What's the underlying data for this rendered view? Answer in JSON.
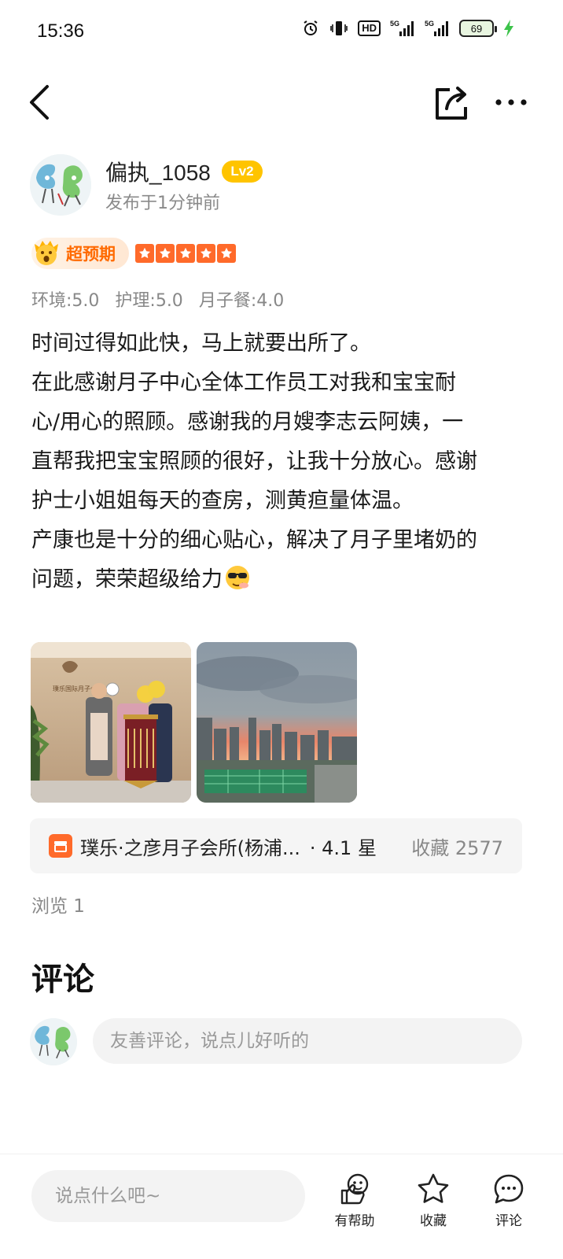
{
  "status_bar": {
    "time": "15:36",
    "icons": [
      "alarm-icon",
      "vibrate-icon",
      "hd-icon",
      "signal-5g-icon",
      "signal-5g-icon"
    ],
    "hd_label": "HD",
    "battery": "69"
  },
  "nav": {
    "icons": [
      "back-arrow-icon",
      "share-icon",
      "more-icon"
    ]
  },
  "author": {
    "name": "偏执_1058",
    "level": "Lv2",
    "posted": "发布于1分钟前"
  },
  "rating": {
    "tag": "超预期",
    "stars": 5,
    "sub": [
      {
        "label": "环境:5.0"
      },
      {
        "label": "护理:5.0"
      },
      {
        "label": "月子餐:4.0"
      }
    ]
  },
  "review": {
    "lines": [
      "时间过得如此快，马上就要出所了。",
      "在此感谢月子中心全体工作员工对我和宝宝耐",
      "心/用心的照顾。感谢我的月嫂李志云阿姨，一",
      "直帮我把宝宝照顾的很好，让我十分放心。感谢",
      "护士小姐姐每天的查房，测黄疸量体温。",
      "产康也是十分的细心贴心，解决了月子里堵奶的",
      "问题，荣荣超级给力"
    ],
    "emoji": "sunglasses-emoji-icon"
  },
  "photos": [
    {
      "alt": "photo-group-banner"
    },
    {
      "alt": "photo-city-sunset"
    }
  ],
  "photo1_texts": {
    "sign": "璞乐国际月子会所",
    "logo": "Fo"
  },
  "place": {
    "name": "璞乐·之彦月子会所(杨浦...",
    "rating": "· 4.1 星",
    "favorites": "收藏 2577"
  },
  "views": "浏览 1",
  "comments": {
    "title": "评论",
    "placeholder": "友善评论，说点儿好听的"
  },
  "bottom_bar": {
    "placeholder": "说点什么吧~",
    "buttons": [
      {
        "label": "有帮助",
        "icon": "thumbs-up-icon"
      },
      {
        "label": "收藏",
        "icon": "star-icon"
      },
      {
        "label": "评论",
        "icon": "comment-icon"
      }
    ]
  },
  "colors": {
    "accent_orange": "#ff6a2a",
    "level_yellow": "#ffc400",
    "muted_text": "#888888",
    "card_bg": "#f5f5f5"
  }
}
